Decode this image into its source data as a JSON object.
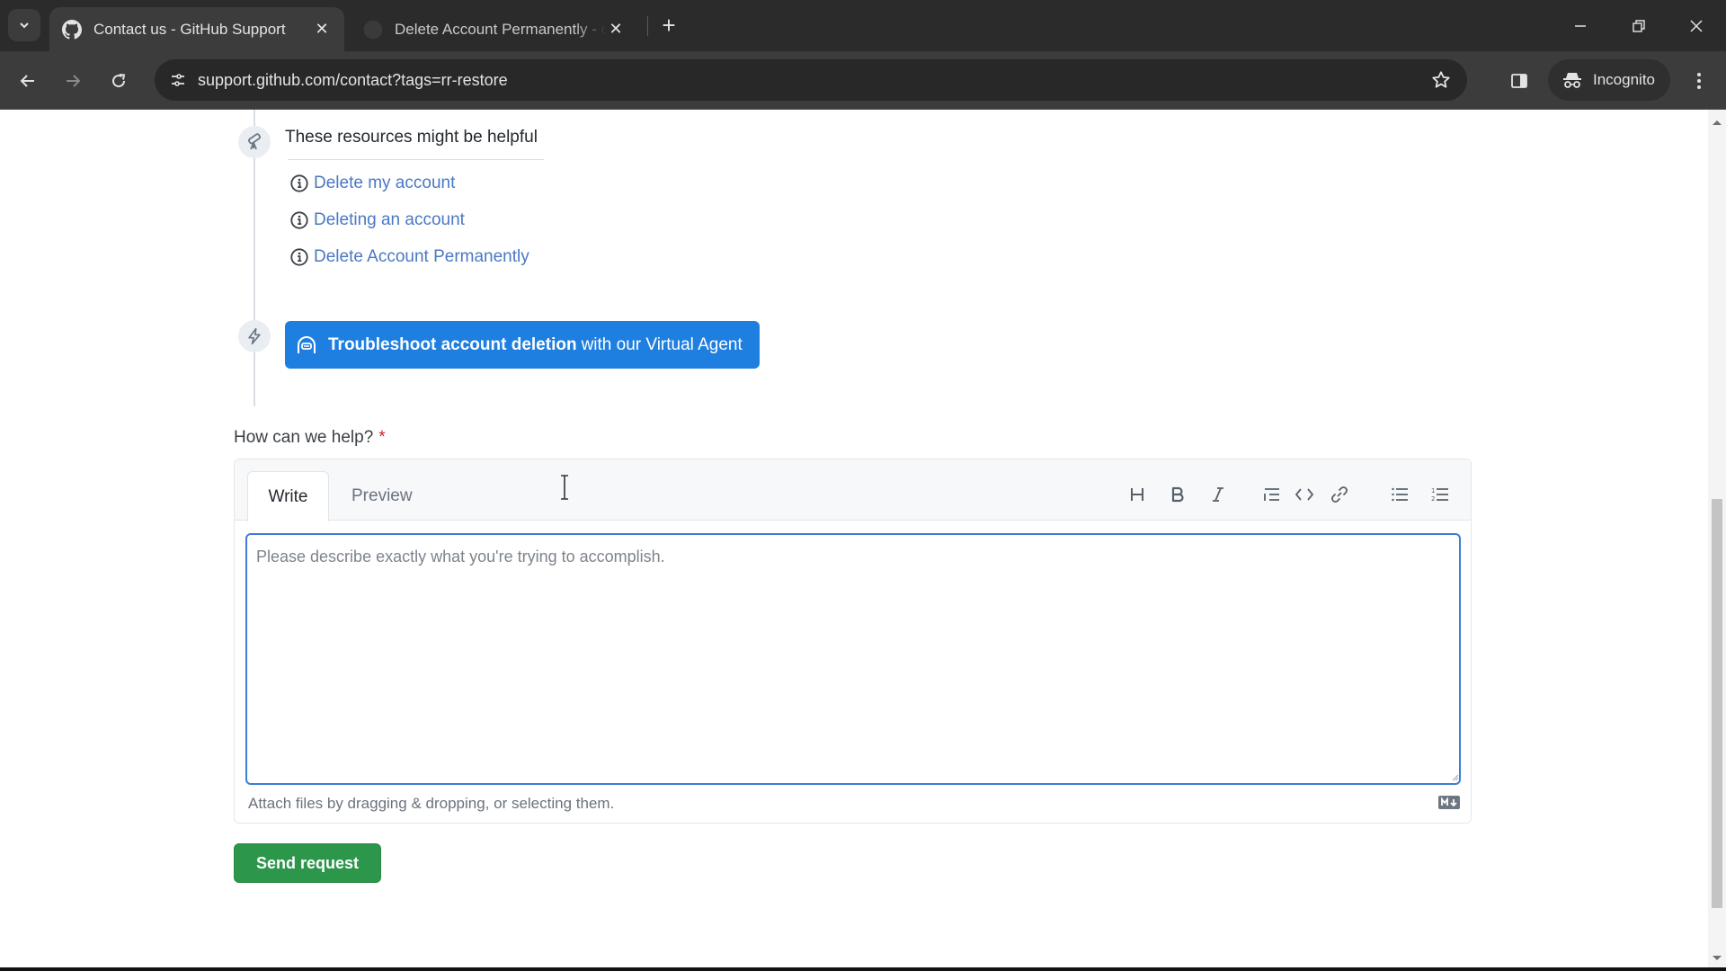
{
  "browser": {
    "tabs": [
      {
        "title": "Contact us - GitHub Support",
        "active": true,
        "icon": "github-icon"
      },
      {
        "title": "Delete Account Permanently - c",
        "active": false,
        "icon": "github-icon"
      }
    ],
    "new_tab_label": "+",
    "url": "support.github.com/contact?tags=rr-restore",
    "incognito_label": "Incognito"
  },
  "resources": {
    "title": "These resources might be helpful",
    "icon": "telescope-icon",
    "links": [
      {
        "label": "Delete my account",
        "icon": "info-icon"
      },
      {
        "label": "Deleting an account",
        "icon": "info-icon"
      },
      {
        "label": "Delete Account Permanently",
        "icon": "info-icon"
      }
    ]
  },
  "virtual_agent": {
    "icon": "copilot-icon",
    "bold_label": "Troubleshoot account deletion",
    "rest_label": "with our Virtual Agent",
    "badge_icon": "zap-icon"
  },
  "form": {
    "label": "How can we help?",
    "required_mark": "*",
    "tabs": [
      "Write",
      "Preview"
    ],
    "active_tab": "Write",
    "toolbar": [
      "heading",
      "bold",
      "italic",
      "quote",
      "code",
      "link",
      "unordered-list",
      "ordered-list"
    ],
    "textarea_value": "",
    "textarea_placeholder": "Please describe exactly what you're trying to accomplish.",
    "attach_text": "Attach files by dragging & dropping, or selecting them.",
    "submit_label": "Send request"
  },
  "colors": {
    "accent_blue": "#1f7fe0",
    "link_blue": "#4a78c4",
    "submit_green": "#2c974b",
    "required_red": "#cf222e"
  }
}
